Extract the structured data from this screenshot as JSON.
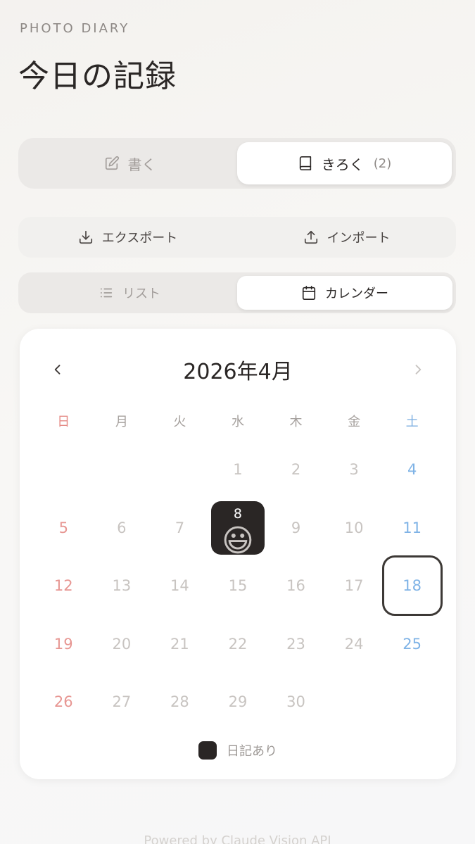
{
  "app": {
    "eyebrow": "PHOTO DIARY",
    "title": "今日の記録"
  },
  "main_tabs": [
    {
      "label": "書く",
      "icon": "pencil-square-icon",
      "active": false
    },
    {
      "label": "きろく",
      "count": "(2)",
      "icon": "book-icon",
      "active": true
    }
  ],
  "actions": {
    "export_label": "エクスポート",
    "import_label": "インポート"
  },
  "view_tabs": [
    {
      "label": "リスト",
      "icon": "list-icon",
      "active": false
    },
    {
      "label": "カレンダー",
      "icon": "calendar-icon",
      "active": true
    }
  ],
  "calendar": {
    "month_label": "2026年4月",
    "weekdays": [
      "日",
      "月",
      "火",
      "水",
      "木",
      "金",
      "土"
    ],
    "leading_blanks": 3,
    "days_in_month": 30,
    "today": 18,
    "entries": [
      {
        "day": 8,
        "emoji": "😃"
      }
    ],
    "legend_label": "日記あり"
  },
  "colors": {
    "sunday": "#e79692",
    "saturday": "#7fb3e6",
    "entry": "#2a2625"
  },
  "footer": "Powered by Claude Vision API"
}
